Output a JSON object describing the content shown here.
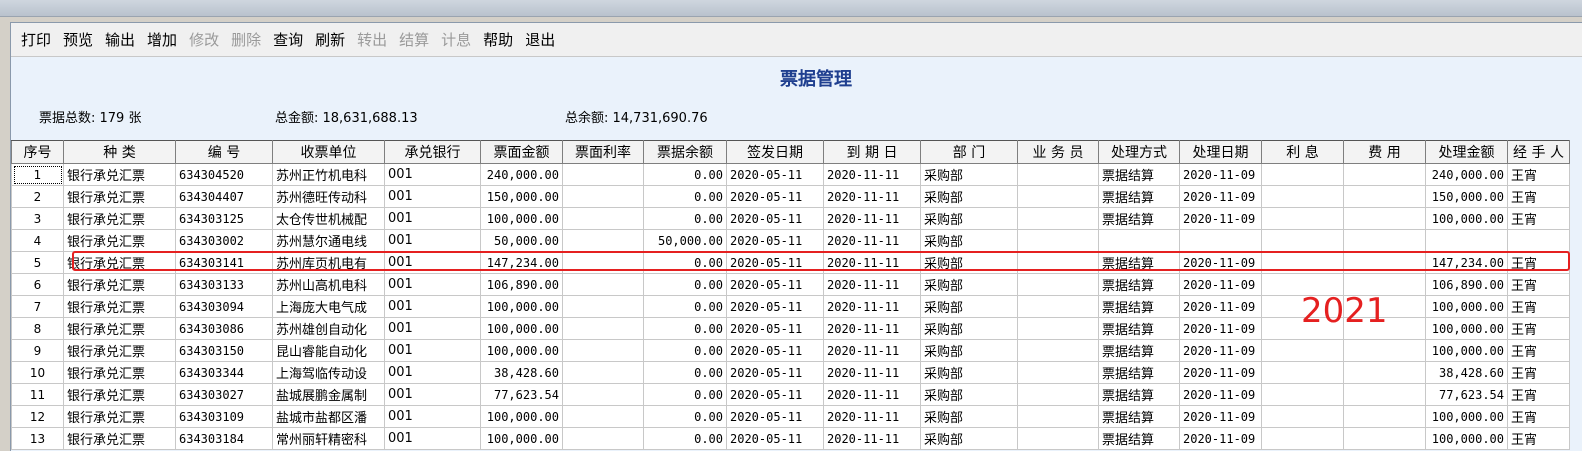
{
  "toolbar": {
    "buttons": [
      {
        "label": "打印",
        "enabled": true
      },
      {
        "label": "预览",
        "enabled": true
      },
      {
        "label": "输出",
        "enabled": true
      },
      {
        "label": "增加",
        "enabled": true
      },
      {
        "label": "修改",
        "enabled": false
      },
      {
        "label": "删除",
        "enabled": false
      },
      {
        "label": "查询",
        "enabled": true
      },
      {
        "label": "刷新",
        "enabled": true
      },
      {
        "label": "转出",
        "enabled": false
      },
      {
        "label": "结算",
        "enabled": false
      },
      {
        "label": "计息",
        "enabled": false
      },
      {
        "label": "帮助",
        "enabled": true
      },
      {
        "label": "退出",
        "enabled": true
      }
    ]
  },
  "page": {
    "title": "票据管理",
    "total_count": "票据总数:  179 张",
    "total_amount": "总金额:  18,631,688.13",
    "total_balance": "总余额:  14,731,690.76"
  },
  "table": {
    "columns": [
      "序号",
      "种  类",
      "编  号",
      "收票单位",
      "承兑银行",
      "票面金额",
      "票面利率",
      "票据余额",
      "签发日期",
      "到 期 日",
      "部  门",
      "业 务 员",
      "处理方式",
      "处理日期",
      "利  息",
      "费  用",
      "处理金额",
      "经 手 人"
    ],
    "rows": [
      [
        "1",
        "银行承兑汇票",
        "634304520",
        "苏州正竹机电科",
        "001",
        "240,000.00",
        "",
        "0.00",
        "2020-05-11",
        "2020-11-11",
        "采购部",
        "",
        "票据结算",
        "2020-11-09",
        "",
        "",
        "240,000.00",
        "王宵"
      ],
      [
        "2",
        "银行承兑汇票",
        "634304407",
        "苏州德旺传动科",
        "001",
        "150,000.00",
        "",
        "0.00",
        "2020-05-11",
        "2020-11-11",
        "采购部",
        "",
        "票据结算",
        "2020-11-09",
        "",
        "",
        "150,000.00",
        "王宵"
      ],
      [
        "3",
        "银行承兑汇票",
        "634303125",
        "太仓传世机械配",
        "001",
        "100,000.00",
        "",
        "0.00",
        "2020-05-11",
        "2020-11-11",
        "采购部",
        "",
        "票据结算",
        "2020-11-09",
        "",
        "",
        "100,000.00",
        "王宵"
      ],
      [
        "4",
        "银行承兑汇票",
        "634303002",
        "苏州慧尔通电线",
        "001",
        "50,000.00",
        "",
        "50,000.00",
        "2020-05-11",
        "2020-11-11",
        "采购部",
        "",
        "",
        "",
        "",
        "",
        "",
        ""
      ],
      [
        "5",
        "银行承兑汇票",
        "634303141",
        "苏州库页机电有",
        "001",
        "147,234.00",
        "",
        "0.00",
        "2020-05-11",
        "2020-11-11",
        "采购部",
        "",
        "票据结算",
        "2020-11-09",
        "",
        "",
        "147,234.00",
        "王宵"
      ],
      [
        "6",
        "银行承兑汇票",
        "634303133",
        "苏州山高机电科",
        "001",
        "106,890.00",
        "",
        "0.00",
        "2020-05-11",
        "2020-11-11",
        "采购部",
        "",
        "票据结算",
        "2020-11-09",
        "",
        "",
        "106,890.00",
        "王宵"
      ],
      [
        "7",
        "银行承兑汇票",
        "634303094",
        "上海庞大电气成",
        "001",
        "100,000.00",
        "",
        "0.00",
        "2020-05-11",
        "2020-11-11",
        "采购部",
        "",
        "票据结算",
        "2020-11-09",
        "",
        "",
        "100,000.00",
        "王宵"
      ],
      [
        "8",
        "银行承兑汇票",
        "634303086",
        "苏州雄创自动化",
        "001",
        "100,000.00",
        "",
        "0.00",
        "2020-05-11",
        "2020-11-11",
        "采购部",
        "",
        "票据结算",
        "2020-11-09",
        "",
        "",
        "100,000.00",
        "王宵"
      ],
      [
        "9",
        "银行承兑汇票",
        "634303150",
        "昆山睿能自动化",
        "001",
        "100,000.00",
        "",
        "0.00",
        "2020-05-11",
        "2020-11-11",
        "采购部",
        "",
        "票据结算",
        "2020-11-09",
        "",
        "",
        "100,000.00",
        "王宵"
      ],
      [
        "10",
        "银行承兑汇票",
        "634303344",
        "上海驾临传动设",
        "001",
        "38,428.60",
        "",
        "0.00",
        "2020-05-11",
        "2020-11-11",
        "采购部",
        "",
        "票据结算",
        "2020-11-09",
        "",
        "",
        "38,428.60",
        "王宵"
      ],
      [
        "11",
        "银行承兑汇票",
        "634303027",
        "盐城展鹏金属制",
        "001",
        "77,623.54",
        "",
        "0.00",
        "2020-05-11",
        "2020-11-11",
        "采购部",
        "",
        "票据结算",
        "2020-11-09",
        "",
        "",
        "77,623.54",
        "王宵"
      ],
      [
        "12",
        "银行承兑汇票",
        "634303109",
        "盐城市盐都区潘",
        "001",
        "100,000.00",
        "",
        "0.00",
        "2020-05-11",
        "2020-11-11",
        "采购部",
        "",
        "票据结算",
        "2020-11-09",
        "",
        "",
        "100,000.00",
        "王宵"
      ],
      [
        "13",
        "银行承兑汇票",
        "634303184",
        "常州丽轩精密科",
        "001",
        "100,000.00",
        "",
        "0.00",
        "2020-05-11",
        "2020-11-11",
        "采购部",
        "",
        "票据结算",
        "2020-11-09",
        "",
        "",
        "100,000.00",
        "王宵"
      ]
    ]
  },
  "annotation": {
    "text": "2021",
    "color": "#e52020"
  },
  "colors": {
    "title": "#1f3f8f",
    "highlight": "#e52020",
    "disabled": "#9a9a9a"
  }
}
